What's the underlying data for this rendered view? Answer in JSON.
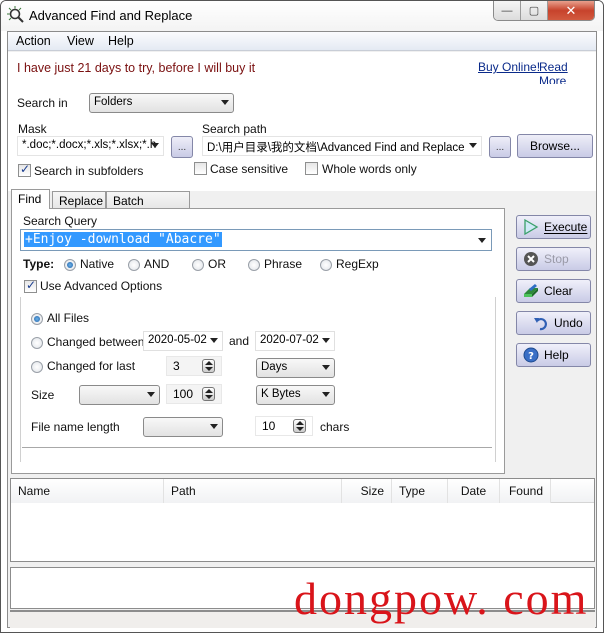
{
  "window": {
    "title": "Advanced Find and Replace",
    "controls": {
      "minimize": "—",
      "maximize": "▢",
      "close": "✕"
    }
  },
  "menu": [
    "Action",
    "View",
    "Help"
  ],
  "nag": {
    "text": "I have just 21 days to try, before I will buy it",
    "buy_online": "Buy Online!",
    "read_more": "Read More"
  },
  "search": {
    "search_in_label": "Search in",
    "search_in_value": "Folders",
    "mask_label": "Mask",
    "mask_value": "*.doc;*.docx;*.xls;*.xlsx;*.h",
    "mask_button": "...",
    "path_label": "Search path",
    "path_value": "D:\\用户目录\\我的文档\\Advanced Find and Replace",
    "path_button": "...",
    "browse_button": "Browse...",
    "subfolders_label": "Search in subfolders",
    "subfolders_checked": true,
    "case_label": "Case sensitive",
    "case_checked": false,
    "whole_words_label": "Whole words only",
    "whole_words_checked": false
  },
  "tabs": [
    {
      "label": "Find",
      "active": true
    },
    {
      "label": "Replace",
      "active": false
    },
    {
      "label": "Batch Replace",
      "active": false
    }
  ],
  "find": {
    "query_label": "Search Query",
    "query_value": "+Enjoy -download \"Abacre\"",
    "type_label": "Type:",
    "types": [
      {
        "label": "Native",
        "selected": true
      },
      {
        "label": "AND",
        "selected": false
      },
      {
        "label": "OR",
        "selected": false
      },
      {
        "label": "Phrase",
        "selected": false
      },
      {
        "label": "RegExp",
        "selected": false
      }
    ],
    "advanced_label": "Use Advanced Options",
    "advanced_checked": true,
    "filters": {
      "all_files": "All Files",
      "all_files_selected": true,
      "changed_between": "Changed between",
      "date_from": "2020-05-02",
      "and_label": "and",
      "date_to": "2020-07-02",
      "changed_for_last": "Changed for last",
      "last_value": "3",
      "last_unit": "Days",
      "size_label": "Size",
      "size_op": "",
      "size_value": "100",
      "size_unit": "K Bytes",
      "fname_label": "File name length",
      "fname_op": "",
      "fname_value": "10",
      "fname_unit": "chars"
    }
  },
  "actions": [
    {
      "label": "Execute",
      "icon": "play-icon",
      "enabled": true
    },
    {
      "label": "Stop",
      "icon": "stop-icon",
      "enabled": false
    },
    {
      "label": "Clear",
      "icon": "eraser-icon",
      "enabled": true
    },
    {
      "label": "Undo",
      "icon": "undo-icon",
      "enabled": true
    },
    {
      "label": "Help",
      "icon": "help-icon",
      "enabled": true
    }
  ],
  "results": {
    "columns": [
      "Name",
      "Path",
      "Size",
      "Type",
      "Date",
      "Found"
    ],
    "rows": []
  },
  "watermark": "dongpow. com"
}
